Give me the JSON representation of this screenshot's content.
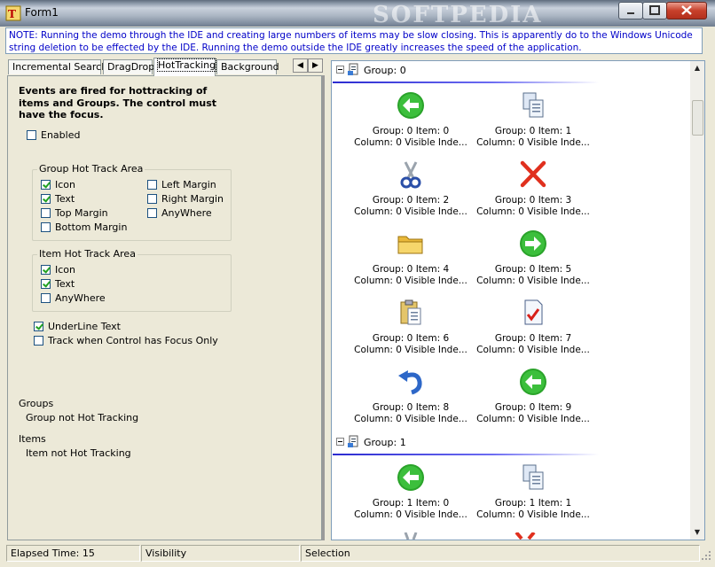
{
  "window": {
    "title": "Form1",
    "watermark": "SOFTPEDIA"
  },
  "note": "NOTE:  Running the demo through the IDE and creating large numbers of items may be slow closing.  This is apparently do to the Windows Unicode string deletion to be effected by the IDE.  Running the demo outside the IDE greatly increases the speed of the application.",
  "tabs": [
    "Incremental Search",
    "DragDrop",
    "HotTracking",
    "Background"
  ],
  "active_tab": "HotTracking",
  "panel": {
    "description": "Events are fired for hottracking of items and Groups.  The control must have the focus.",
    "enabled_label": "Enabled",
    "enabled_checked": false,
    "group_area": {
      "title": "Group Hot Track Area",
      "options": [
        {
          "label": "Icon",
          "checked": true
        },
        {
          "label": "Text",
          "checked": true
        },
        {
          "label": "Top Margin",
          "checked": false
        },
        {
          "label": "Bottom Margin",
          "checked": false
        },
        {
          "label": "Left Margin",
          "checked": false
        },
        {
          "label": "Right Margin",
          "checked": false
        },
        {
          "label": "AnyWhere",
          "checked": false
        }
      ]
    },
    "item_area": {
      "title": "Item Hot Track Area",
      "options": [
        {
          "label": "Icon",
          "checked": true
        },
        {
          "label": "Text",
          "checked": true
        },
        {
          "label": "AnyWhere",
          "checked": false
        }
      ]
    },
    "underline_label": "UnderLine Text",
    "underline_checked": true,
    "track_focus_label": "Track when Control has Focus Only",
    "track_focus_checked": false,
    "groups_heading": "Groups",
    "groups_status": "Group not Hot Tracking",
    "items_heading": "Items",
    "items_status": "Item not Hot Tracking"
  },
  "listview": {
    "groups": [
      {
        "label": "Group: 0",
        "items": [
          {
            "line1": "Group: 0 Item: 0",
            "line2": "Column: 0 Visible Inde...",
            "icon": "arrow-left-green-icon"
          },
          {
            "line1": "Group: 0 Item: 1",
            "line2": "Column: 0 Visible Inde...",
            "icon": "copy-icon"
          },
          {
            "line1": "Group: 0 Item: 2",
            "line2": "Column: 0 Visible Inde...",
            "icon": "scissors-icon"
          },
          {
            "line1": "Group: 0 Item: 3",
            "line2": "Column: 0 Visible Inde...",
            "icon": "delete-x-icon"
          },
          {
            "line1": "Group: 0 Item: 4",
            "line2": "Column: 0 Visible Inde...",
            "icon": "folder-icon"
          },
          {
            "line1": "Group: 0 Item: 5",
            "line2": "Column: 0 Visible Inde...",
            "icon": "arrow-right-green-icon"
          },
          {
            "line1": "Group: 0 Item: 6",
            "line2": "Column: 0 Visible Inde...",
            "icon": "clipboard-icon"
          },
          {
            "line1": "Group: 0 Item: 7",
            "line2": "Column: 0 Visible Inde...",
            "icon": "document-check-icon"
          },
          {
            "line1": "Group: 0 Item: 8",
            "line2": "Column: 0 Visible Inde...",
            "icon": "undo-icon"
          },
          {
            "line1": "Group: 0 Item: 9",
            "line2": "Column: 0 Visible Inde...",
            "icon": "arrow-left-green-icon"
          }
        ]
      },
      {
        "label": "Group: 1",
        "items": [
          {
            "line1": "Group: 1 Item: 0",
            "line2": "Column: 0 Visible Inde...",
            "icon": "arrow-left-green-icon"
          },
          {
            "line1": "Group: 1 Item: 1",
            "line2": "Column: 0 Visible Inde...",
            "icon": "copy-icon"
          }
        ]
      }
    ]
  },
  "statusbar": {
    "elapsed": "Elapsed Time: 15",
    "visibility": "Visibility",
    "selection": "Selection"
  },
  "colors": {
    "note_text": "#0000c8",
    "group_line": "#2b2bd0",
    "accent_green": "#21a121"
  }
}
